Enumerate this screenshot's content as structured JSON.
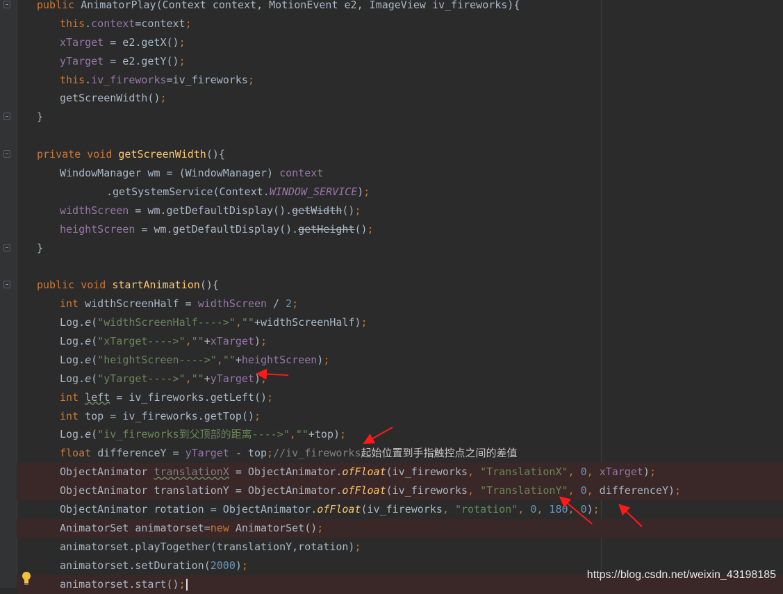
{
  "editor": {
    "lines": [
      {
        "indent": 1,
        "fold": true,
        "hl": false,
        "tokens": [
          [
            "k",
            "public "
          ],
          [
            "p",
            "AnimatorPlay(Context context, MotionEvent e2, ImageView iv_fireworks){"
          ]
        ]
      },
      {
        "indent": 2,
        "fold": false,
        "hl": false,
        "tokens": [
          [
            "k",
            "this"
          ],
          [
            "p",
            "."
          ],
          [
            "f",
            "context"
          ],
          [
            "p",
            "=context"
          ],
          [
            "k",
            ";"
          ]
        ]
      },
      {
        "indent": 2,
        "fold": false,
        "hl": false,
        "tokens": [
          [
            "f",
            "xTarget"
          ],
          [
            "p",
            " = e2.getX()"
          ],
          [
            "k",
            ";"
          ]
        ]
      },
      {
        "indent": 2,
        "fold": false,
        "hl": false,
        "tokens": [
          [
            "f",
            "yTarget"
          ],
          [
            "p",
            " = e2.getY()"
          ],
          [
            "k",
            ";"
          ]
        ]
      },
      {
        "indent": 2,
        "fold": false,
        "hl": false,
        "tokens": [
          [
            "k",
            "this"
          ],
          [
            "p",
            "."
          ],
          [
            "f",
            "iv_fireworks"
          ],
          [
            "p",
            "=iv_fireworks"
          ],
          [
            "k",
            ";"
          ]
        ]
      },
      {
        "indent": 2,
        "fold": false,
        "hl": false,
        "tokens": [
          [
            "p",
            "getScreenWidth()"
          ],
          [
            "k",
            ";"
          ]
        ]
      },
      {
        "indent": 1,
        "fold": true,
        "hl": false,
        "tokens": [
          [
            "p",
            "}"
          ]
        ]
      },
      {
        "indent": 0,
        "fold": false,
        "hl": false,
        "tokens": []
      },
      {
        "indent": 1,
        "fold": true,
        "hl": false,
        "tokens": [
          [
            "k",
            "private void "
          ],
          [
            "m",
            "getScreenWidth"
          ],
          [
            "p",
            "(){"
          ]
        ]
      },
      {
        "indent": 2,
        "fold": false,
        "hl": false,
        "tokens": [
          [
            "p",
            "WindowManager wm = (WindowManager) "
          ],
          [
            "f",
            "context"
          ]
        ]
      },
      {
        "indent": 4,
        "fold": false,
        "hl": false,
        "tokens": [
          [
            "p",
            ".getSystemService(Context."
          ],
          [
            "i",
            "WINDOW_SERVICE"
          ],
          [
            "p",
            ")"
          ],
          [
            "k",
            ";"
          ]
        ]
      },
      {
        "indent": 2,
        "fold": false,
        "hl": false,
        "tokens": [
          [
            "f",
            "widthScreen"
          ],
          [
            "p",
            " = wm.getDefaultDisplay()."
          ],
          [
            "strike",
            "getWidth"
          ],
          [
            "p",
            "()"
          ],
          [
            "k",
            ";"
          ]
        ]
      },
      {
        "indent": 2,
        "fold": false,
        "hl": false,
        "tokens": [
          [
            "f",
            "heightScreen"
          ],
          [
            "p",
            " = wm.getDefaultDisplay()."
          ],
          [
            "strike",
            "getHeight"
          ],
          [
            "p",
            "()"
          ],
          [
            "k",
            ";"
          ]
        ]
      },
      {
        "indent": 1,
        "fold": true,
        "hl": false,
        "tokens": [
          [
            "p",
            "}"
          ]
        ]
      },
      {
        "indent": 0,
        "fold": false,
        "hl": false,
        "tokens": []
      },
      {
        "indent": 1,
        "fold": true,
        "hl": false,
        "tokens": [
          [
            "k",
            "public void "
          ],
          [
            "m",
            "startAnimation"
          ],
          [
            "p",
            "(){"
          ]
        ]
      },
      {
        "indent": 2,
        "fold": false,
        "hl": false,
        "tokens": [
          [
            "k",
            "int "
          ],
          [
            "p",
            "widthScreenHalf = "
          ],
          [
            "f",
            "widthScreen"
          ],
          [
            "p",
            " / "
          ],
          [
            "n",
            "2"
          ],
          [
            "k",
            ";"
          ]
        ]
      },
      {
        "indent": 2,
        "fold": false,
        "hl": false,
        "tokens": [
          [
            "p",
            "Log."
          ],
          [
            "st",
            "e"
          ],
          [
            "p",
            "("
          ],
          [
            "s",
            "\"widthScreenHalf---->\""
          ],
          [
            "k",
            ","
          ],
          [
            "s",
            "\"\""
          ],
          [
            "p",
            "+widthScreenHalf)"
          ],
          [
            "k",
            ";"
          ]
        ]
      },
      {
        "indent": 2,
        "fold": false,
        "hl": false,
        "tokens": [
          [
            "p",
            "Log."
          ],
          [
            "st",
            "e"
          ],
          [
            "p",
            "("
          ],
          [
            "s",
            "\"xTarget---->\""
          ],
          [
            "k",
            ","
          ],
          [
            "s",
            "\"\""
          ],
          [
            "p",
            "+"
          ],
          [
            "f",
            "xTarget"
          ],
          [
            "p",
            ")"
          ],
          [
            "k",
            ";"
          ]
        ]
      },
      {
        "indent": 2,
        "fold": false,
        "hl": false,
        "tokens": [
          [
            "p",
            "Log."
          ],
          [
            "st",
            "e"
          ],
          [
            "p",
            "("
          ],
          [
            "s",
            "\"heightScreen---->\""
          ],
          [
            "k",
            ","
          ],
          [
            "s",
            "\"\""
          ],
          [
            "p",
            "+"
          ],
          [
            "f",
            "heightScreen"
          ],
          [
            "p",
            ")"
          ],
          [
            "k",
            ";"
          ]
        ]
      },
      {
        "indent": 2,
        "fold": false,
        "hl": false,
        "tokens": [
          [
            "p",
            "Log."
          ],
          [
            "st",
            "e"
          ],
          [
            "p",
            "("
          ],
          [
            "s",
            "\"yTarget---->\""
          ],
          [
            "k",
            ","
          ],
          [
            "s",
            "\"\""
          ],
          [
            "p",
            "+"
          ],
          [
            "f",
            "yTarget"
          ],
          [
            "p",
            ")"
          ],
          [
            "k",
            ";"
          ]
        ]
      },
      {
        "indent": 2,
        "fold": false,
        "hl": false,
        "tokens": [
          [
            "k",
            "int "
          ],
          [
            "wavy",
            "left"
          ],
          [
            "p",
            " = iv_fireworks.getLeft()"
          ],
          [
            "k",
            ";"
          ]
        ]
      },
      {
        "indent": 2,
        "fold": false,
        "hl": false,
        "tokens": [
          [
            "k",
            "int "
          ],
          [
            "p",
            "top = iv_fireworks.getTop()"
          ],
          [
            "k",
            ";"
          ]
        ]
      },
      {
        "indent": 2,
        "fold": false,
        "hl": false,
        "tokens": [
          [
            "p",
            "Log."
          ],
          [
            "st",
            "e"
          ],
          [
            "p",
            "("
          ],
          [
            "s",
            "\"iv_fireworks到父顶部的距离---->\""
          ],
          [
            "k",
            ","
          ],
          [
            "s",
            "\"\""
          ],
          [
            "p",
            "+top)"
          ],
          [
            "k",
            ";"
          ]
        ]
      },
      {
        "indent": 2,
        "fold": false,
        "hl": false,
        "tokens": [
          [
            "k",
            "float "
          ],
          [
            "p",
            "differenceY = "
          ],
          [
            "f",
            "yTarget"
          ],
          [
            "p",
            " - top"
          ],
          [
            "k",
            ";"
          ],
          [
            "c",
            "//iv_fireworks"
          ],
          [
            "cz",
            "起始位置到手指触控点之间的差值"
          ]
        ]
      },
      {
        "indent": 2,
        "fold": false,
        "hl": true,
        "tokens": [
          [
            "p",
            "ObjectAnimator "
          ],
          [
            "wavygray",
            "translationX"
          ],
          [
            "p",
            " = ObjectAnimator."
          ],
          [
            "i2",
            "ofFloat"
          ],
          [
            "p",
            "(iv_fireworks"
          ],
          [
            "k",
            ", "
          ],
          [
            "s",
            "\"TranslationX\""
          ],
          [
            "k",
            ", "
          ],
          [
            "n",
            "0"
          ],
          [
            "k",
            ", "
          ],
          [
            "f",
            "xTarget"
          ],
          [
            "p",
            ")"
          ],
          [
            "k",
            ";"
          ]
        ]
      },
      {
        "indent": 2,
        "fold": false,
        "hl": true,
        "tokens": [
          [
            "p",
            "ObjectAnimator translationY = ObjectAnimator."
          ],
          [
            "i2",
            "ofFloat"
          ],
          [
            "p",
            "(iv_fireworks"
          ],
          [
            "k",
            ", "
          ],
          [
            "s",
            "\"TranslationY\""
          ],
          [
            "k",
            ", "
          ],
          [
            "n",
            "0"
          ],
          [
            "k",
            ", "
          ],
          [
            "p",
            "differenceY)"
          ],
          [
            "k",
            ";"
          ]
        ]
      },
      {
        "indent": 2,
        "fold": false,
        "hl": false,
        "tokens": [
          [
            "p",
            "ObjectAnimator rotation = ObjectAnimator."
          ],
          [
            "i2",
            "ofFloat"
          ],
          [
            "p",
            "(iv_fireworks"
          ],
          [
            "k",
            ", "
          ],
          [
            "s",
            "\"rotation\""
          ],
          [
            "k",
            ", "
          ],
          [
            "n",
            "0"
          ],
          [
            "k",
            ", "
          ],
          [
            "n",
            "180"
          ],
          [
            "k",
            ", "
          ],
          [
            "n",
            "0"
          ],
          [
            "p",
            ")"
          ],
          [
            "k",
            ";"
          ]
        ]
      },
      {
        "indent": 2,
        "fold": false,
        "hl": true,
        "tokens": [
          [
            "p",
            "AnimatorSet animatorset="
          ],
          [
            "k",
            "new "
          ],
          [
            "p",
            "AnimatorSet()"
          ],
          [
            "k",
            ";"
          ]
        ]
      },
      {
        "indent": 2,
        "fold": false,
        "hl": false,
        "tokens": [
          [
            "p",
            "animatorset.playTogether(translationY,rotation)"
          ],
          [
            "k",
            ";"
          ]
        ]
      },
      {
        "indent": 2,
        "fold": false,
        "hl": false,
        "tokens": [
          [
            "p",
            "animatorset.setDuration("
          ],
          [
            "n",
            "2000"
          ],
          [
            "p",
            ")"
          ],
          [
            "k",
            ";"
          ]
        ]
      },
      {
        "indent": 2,
        "fold": false,
        "hl": true,
        "caret": true,
        "tokens": [
          [
            "p",
            "animatorset.start()"
          ],
          [
            "k",
            ";"
          ]
        ]
      }
    ]
  },
  "colors": {
    "background": "#2b2b2b",
    "keyword": "#cc7832",
    "field": "#9876aa",
    "string": "#6a8759",
    "number": "#6897bb",
    "method": "#ffc66d",
    "plain": "#a9b7c6",
    "arrow": "#ff1a1a"
  },
  "icons": {
    "bulb": "lightbulb-icon",
    "fold": "fold-marker-icon"
  },
  "watermark": "https://blog.csdn.net/weixin_43198185"
}
